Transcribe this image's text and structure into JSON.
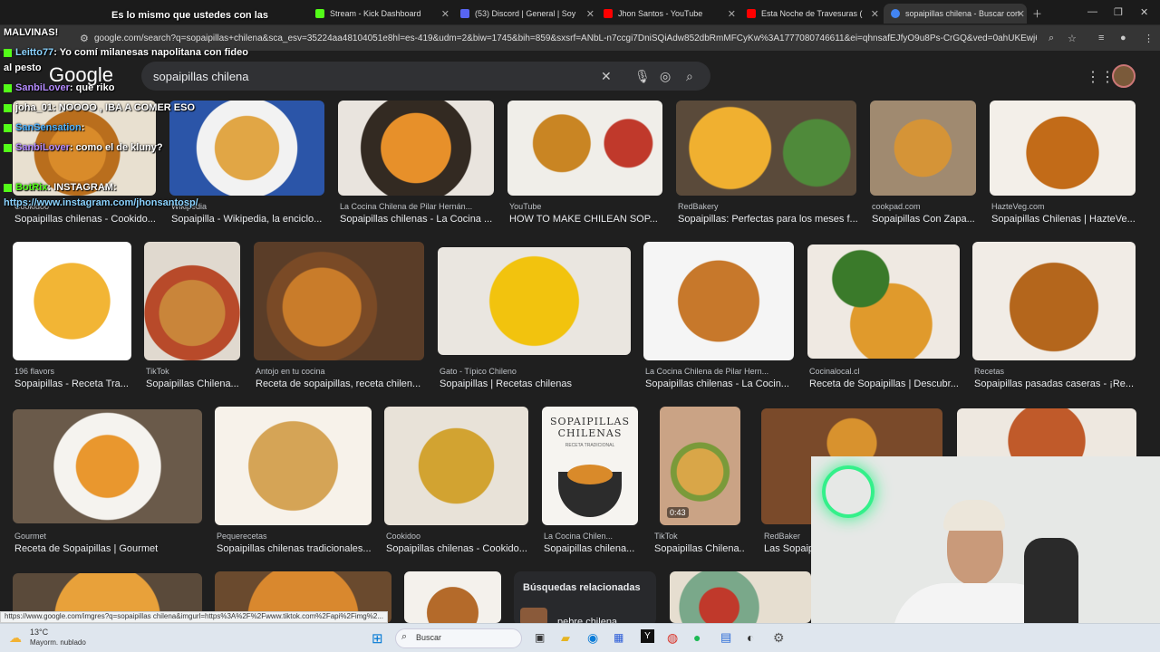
{
  "tabs": [
    {
      "title": "Stream - Kick Dashboard",
      "color": "#53fc18"
    },
    {
      "title": "(53) Discord | General | Soy",
      "color": "#5865f2"
    },
    {
      "title": "Jhon Santos - YouTube",
      "color": "#ff0000"
    },
    {
      "title": "Esta Noche de Travesuras (",
      "color": "#ff0000"
    },
    {
      "title": "sopaipillas chilena - Buscar con",
      "color": "#4285f4"
    }
  ],
  "address": {
    "url": "google.com/search?q=sopaipillas+chilena&sca_esv=35224aa48104051e8hl=es-419&udm=2&biw=1745&bih=859&sxsrf=ANbL-n7ccgi7DniSQiAdw852dbRmMFCyKw%3A1777080746611&ei=qhnsafEJfyO9u8Ps-CrGQ&ved=0ahUKEwj6gY7V7YeUAxV8"
  },
  "google": {
    "logo": "Google",
    "query": "sopaipillas chilena"
  },
  "results": [
    {
      "source": "Cookidoo",
      "title": "Sopaipillas chilenas - Cookido..."
    },
    {
      "source": "Wikipedia",
      "title": "Sopaipilla - Wikipedia, la enciclo..."
    },
    {
      "source": "La Cocina Chilena de Pilar Hernán...",
      "title": "Sopaipillas chilenas - La Cocina ..."
    },
    {
      "source": "YouTube",
      "title": "HOW TO MAKE CHILEAN SOP..."
    },
    {
      "source": "RedBakery",
      "title": "Sopaipillas: Perfectas para los meses f..."
    },
    {
      "source": "cookpad.com",
      "title": "Sopaipillas Con Zapa..."
    },
    {
      "source": "HazteVeg.com",
      "title": "Sopaipillas Chilenas | HazteVe..."
    },
    {
      "source": "196 flavors",
      "title": "Sopaipillas - Receta Tra..."
    },
    {
      "source": "TikTok",
      "title": "Sopaipillas Chilena..."
    },
    {
      "source": "Antojo en tu cocina",
      "title": "Receta de sopaipillas, receta chilen..."
    },
    {
      "source": "Gato - Típico Chileno",
      "title": "Sopaipillas | Recetas chilenas"
    },
    {
      "source": "La Cocina Chilena de Pilar Hern...",
      "title": "Sopaipillas chilenas - La Cocin..."
    },
    {
      "source": "Cocinalocal.cl",
      "title": "Receta de Sopaipillas | Descubr..."
    },
    {
      "source": "Recetas",
      "title": "Sopaipillas pasadas caseras - ¡Re..."
    },
    {
      "source": "Gourmet",
      "title": "Receta de Sopaipillas | Gourmet"
    },
    {
      "source": "Pequerecetas",
      "title": "Sopaipillas chilenas tradicionales..."
    },
    {
      "source": "Cookidoo",
      "title": "Sopaipillas chilenas - Cookido..."
    },
    {
      "source": "La Cocina Chilen...",
      "title": "Sopaipillas chilena..."
    },
    {
      "source": "TikTok",
      "title": "Sopaipillas Chilena..."
    },
    {
      "source": "RedBaker",
      "title": "Las Sopaip"
    }
  ],
  "thumb_text": {
    "book_title": "SOPAIPILLAS CHILENAS",
    "book_sub": "RECETA TRADICIONAL",
    "duration": "0:43"
  },
  "related": {
    "title": "Búsquedas relacionadas",
    "item": "pebre chilena"
  },
  "chat": [
    {
      "user": "MALVINAS!",
      "msg": ""
    },
    {
      "user": "Leitto77",
      "msg": ": Yo comí milanesas napolitana con fideo"
    },
    {
      "user": "al pesto",
      "msg": ""
    },
    {
      "user": "SanbiLover",
      "msg": ": que riko"
    },
    {
      "user": "joha_01",
      "msg": ": NOOOO , IBA A COMER ESO"
    },
    {
      "user": "SanSensation",
      "msg": ":"
    },
    {
      "user": "SanbiLover",
      "msg": ": como el de kluny?"
    },
    {
      "user": "BotRix",
      "msg": ": INSTAGRAM:"
    },
    {
      "user": "https://www.instagram.com/jhonsantosp/",
      "msg": ""
    },
    {
      "user": "Es lo mismo que ustedes con las",
      "msg": ""
    }
  ],
  "status_url": "https://www.google.com/imgres?q=sopaipillas chilena&imgurl=https%3A%2F%2Fwww.tiktok.com%2Fapi%2Fimg%2...",
  "weather": {
    "temp": "13°C",
    "desc": "Mayorm. nublado"
  },
  "taskbar": {
    "search": "Buscar"
  }
}
